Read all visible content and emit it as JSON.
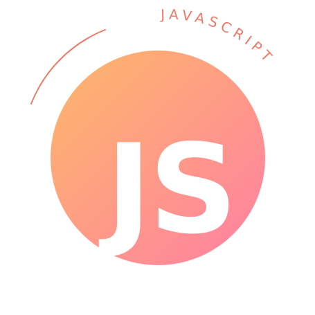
{
  "logo": {
    "monogram": "JS",
    "arc_label": "JAVASCRIPT",
    "colors": {
      "gradient_start": "#FDB869",
      "gradient_end": "#FF7FA3",
      "accent": "#F07A68",
      "monogram": "#FFFFFF",
      "background": "#FFFFFF"
    }
  }
}
